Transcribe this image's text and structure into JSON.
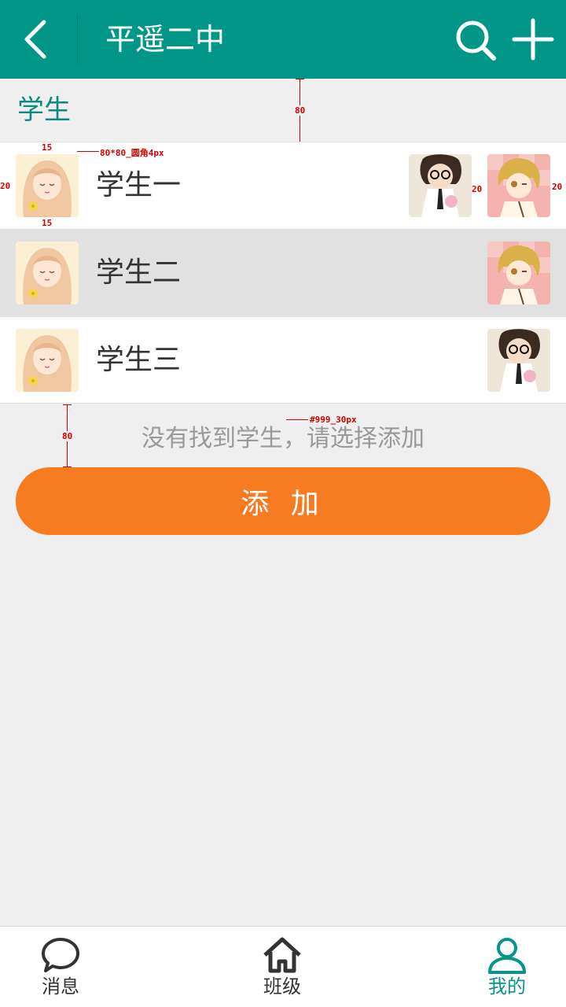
{
  "header": {
    "title": "平遥二中",
    "back_icon": "chevron-left-icon",
    "search_icon": "search-icon",
    "add_icon": "plus-icon",
    "color": "#019688"
  },
  "section": {
    "title": "学生"
  },
  "students": [
    {
      "name": "学生一",
      "selected": false,
      "children": [
        "girl-glasses",
        "boy-blond"
      ]
    },
    {
      "name": "学生二",
      "selected": true,
      "children": [
        "boy-blond"
      ]
    },
    {
      "name": "学生三",
      "selected": false,
      "children": [
        "girl-glasses"
      ]
    }
  ],
  "hint": "没有找到学生，请选择添加",
  "add_button": "添 加",
  "add_button_color": "#f77b20",
  "annotations": {
    "header_gap": "80",
    "avatar_spec": "80*80_圆角4px",
    "pad_top": "15",
    "pad_bottom": "15",
    "left_pad": "20",
    "avatar_gap": "20",
    "right_pad": "20",
    "hint_gap": "80",
    "hint_spec": "#999_30px"
  },
  "nav": {
    "items": [
      {
        "label": "消息",
        "icon": "chat-bubble-icon",
        "active": false
      },
      {
        "label": "班级",
        "icon": "home-icon",
        "active": false
      },
      {
        "label": "我的",
        "icon": "user-icon",
        "active": true
      }
    ],
    "active_color": "#079589"
  }
}
